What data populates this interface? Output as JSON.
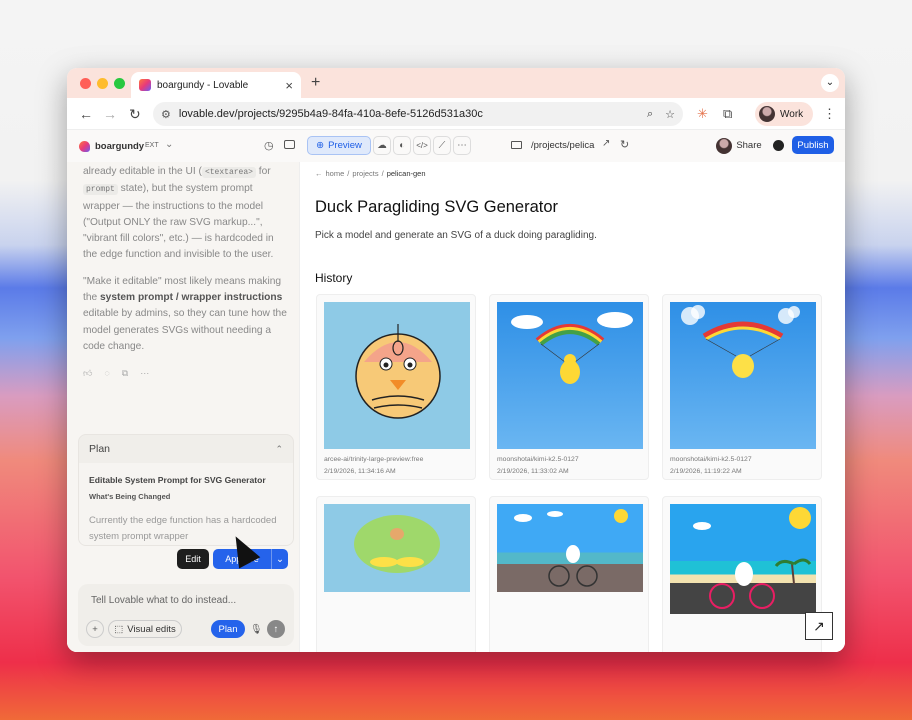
{
  "browser": {
    "tab_title": "boargundy - Lovable",
    "close_glyph": "×",
    "new_tab_glyph": "+",
    "url": "lovable.dev/projects/9295b4a9-84fa-410a-8efe-5126d531a30c",
    "profile_label": "Work",
    "menu_glyph": "⋮",
    "traffic_colors": [
      "#ff5f57",
      "#febc2e",
      "#28c840"
    ]
  },
  "app": {
    "project_name": "boargundy",
    "badge": "EXT",
    "preview_label": "Preview",
    "route": "/projects/pelica",
    "share_label": "Share",
    "publish_label": "Publish",
    "accent": "#1f5fe6"
  },
  "chat": {
    "p1_a": "already editable in the UI (",
    "p1_code1": "<textarea>",
    "p1_b": " for",
    "p1_code2": "prompt",
    "p1_c": " state), but the system prompt wrapper — the instructions to the model (\"Output ONLY the raw SVG markup...\", \"vibrant fill colors\", etc.) — is hardcoded in the edge function and invisible to the user.",
    "p2_a": "\"Make it editable\" most likely means making the ",
    "p2_bold": "system prompt / wrapper instructions",
    "p2_b": " editable by admins, so they can tune how the model generates SVGs without needing a code change."
  },
  "plan": {
    "header": "Plan",
    "title": "Editable System Prompt for SVG Generator",
    "subtitle": "What's Being Changed",
    "body": "Currently the edge function has a hardcoded system prompt wrapper",
    "edit_label": "Edit",
    "approve_label": "Approve"
  },
  "composer": {
    "placeholder": "Tell Lovable what to do instead...",
    "visual_edits_label": "Visual edits",
    "plan_label": "Plan"
  },
  "preview": {
    "breadcrumb": [
      "home",
      "projects",
      "pelican-gen"
    ],
    "back_glyph": "←",
    "title": "Duck Paragliding SVG Generator",
    "description": "Pick a model and generate an SVG of a duck doing paragliding.",
    "history_heading": "History",
    "cards": [
      {
        "model": "arcee-ai/trinity-large-preview:free",
        "time": "2/19/2026, 11:34:16 AM"
      },
      {
        "model": "moonshotai/kimi-k2.5-0127",
        "time": "2/19/2026, 11:33:02 AM"
      },
      {
        "model": "moonshotai/kimi-k2.5-0127",
        "time": "2/19/2026, 11:19:22 AM"
      },
      {
        "model": "",
        "time": ""
      },
      {
        "model": "",
        "time": ""
      },
      {
        "model": "",
        "time": ""
      }
    ]
  }
}
